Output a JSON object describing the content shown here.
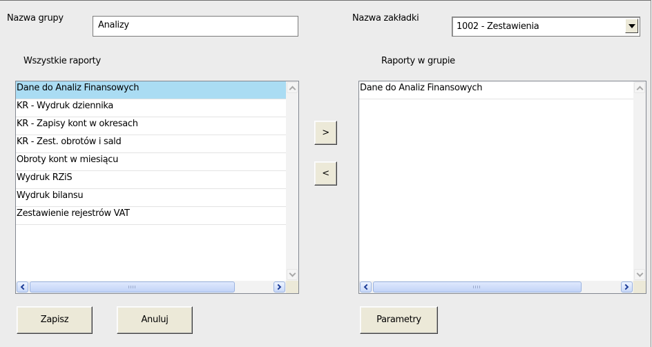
{
  "group": {
    "label": "Nazwa grupy",
    "value": "Analizy"
  },
  "tab": {
    "label": "Nazwa zakładki",
    "selected": "1002 - Zestawienia"
  },
  "all_reports": {
    "header": "Wszystkie raporty",
    "items": [
      "Dane do Analiz Finansowych",
      "KR - Wydruk dziennika",
      "KR - Zapisy kont w okresach",
      "KR - Zest. obrotów i sald",
      "Obroty kont w miesiącu",
      "Wydruk RZiS",
      "Wydruk bilansu",
      "Zestawienie rejestrów VAT"
    ],
    "selected_index": 0
  },
  "group_reports": {
    "header": "Raporty w grupie",
    "items": [
      "Dane do Analiz Finansowych"
    ]
  },
  "transfer": {
    "add_label": ">",
    "remove_label": "<"
  },
  "buttons": {
    "save": "Zapisz",
    "cancel": "Anuluj",
    "params": "Parametry"
  },
  "icons": {
    "dropdown": "chevron-down-icon",
    "scroll_up": "chevron-up-icon",
    "scroll_down": "chevron-down-icon",
    "scroll_left": "chevron-left-icon",
    "scroll_right": "chevron-right-icon"
  }
}
